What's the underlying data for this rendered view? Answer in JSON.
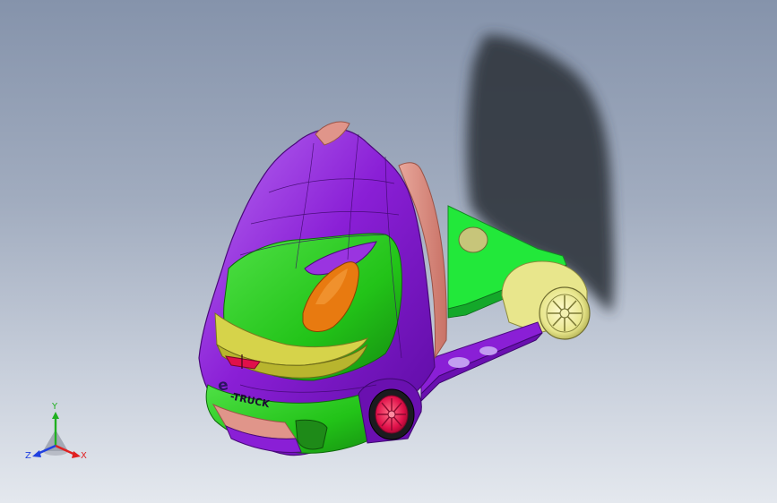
{
  "model": {
    "cab_logo": "e",
    "cab_badge": "-TRUCK",
    "colors": {
      "cab_purple": "#8a1fd6",
      "cab_green": "#22c318",
      "chassis_green": "#22e83a",
      "salmon": "#e0958a",
      "window_orange": "#e87a10",
      "rim_red": "#e0104a",
      "rim_yellow": "#e8e68c",
      "lamp_yellow": "#d6d34a",
      "shadow": "#3a3e48"
    }
  },
  "triad": {
    "x_label": "X",
    "y_label": "Y",
    "z_label": "Z",
    "colors": {
      "x": "#e02020",
      "y": "#20b020",
      "z": "#2040e0"
    }
  }
}
